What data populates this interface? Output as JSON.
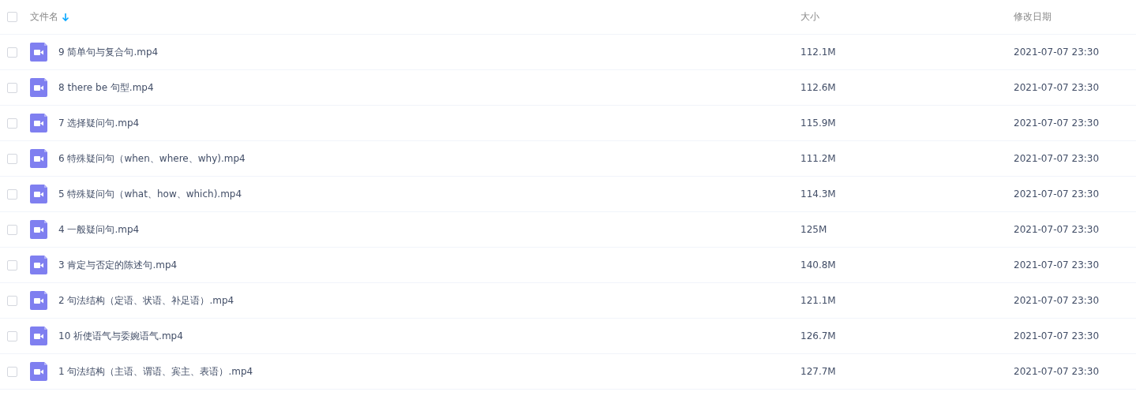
{
  "table": {
    "header": {
      "checked": false,
      "columns": [
        {
          "label": "文件名",
          "sorted": true
        },
        {
          "label": "大小",
          "sorted": false
        },
        {
          "label": "修改日期",
          "sorted": false
        }
      ]
    },
    "rows": [
      {
        "checked": false,
        "kind": "video",
        "name": "9 简单句与复合句.mp4",
        "size": "112.1M",
        "modified": "2021-07-07 23:30"
      },
      {
        "checked": false,
        "kind": "video",
        "name": "8 there be 句型.mp4",
        "size": "112.6M",
        "modified": "2021-07-07 23:30"
      },
      {
        "checked": false,
        "kind": "video",
        "name": "7 选择疑问句.mp4",
        "size": "115.9M",
        "modified": "2021-07-07 23:30"
      },
      {
        "checked": false,
        "kind": "video",
        "name": "6 特殊疑问句（when、where、why).mp4",
        "size": "111.2M",
        "modified": "2021-07-07 23:30"
      },
      {
        "checked": false,
        "kind": "video",
        "name": "5 特殊疑问句（what、how、which).mp4",
        "size": "114.3M",
        "modified": "2021-07-07 23:30"
      },
      {
        "checked": false,
        "kind": "video",
        "name": "4 一般疑问句.mp4",
        "size": "125M",
        "modified": "2021-07-07 23:30"
      },
      {
        "checked": false,
        "kind": "video",
        "name": "3 肯定与否定的陈述句.mp4",
        "size": "140.8M",
        "modified": "2021-07-07 23:30"
      },
      {
        "checked": false,
        "kind": "video",
        "name": "2 句法结构（定语、状语、补足语）.mp4",
        "size": "121.1M",
        "modified": "2021-07-07 23:30"
      },
      {
        "checked": false,
        "kind": "video",
        "name": "10 祈使语气与委婉语气.mp4",
        "size": "126.7M",
        "modified": "2021-07-07 23:30"
      },
      {
        "checked": false,
        "kind": "video",
        "name": "1 句法结构（主语、谓语、宾主、表语）.mp4",
        "size": "127.7M",
        "modified": "2021-07-07 23:30"
      }
    ]
  }
}
